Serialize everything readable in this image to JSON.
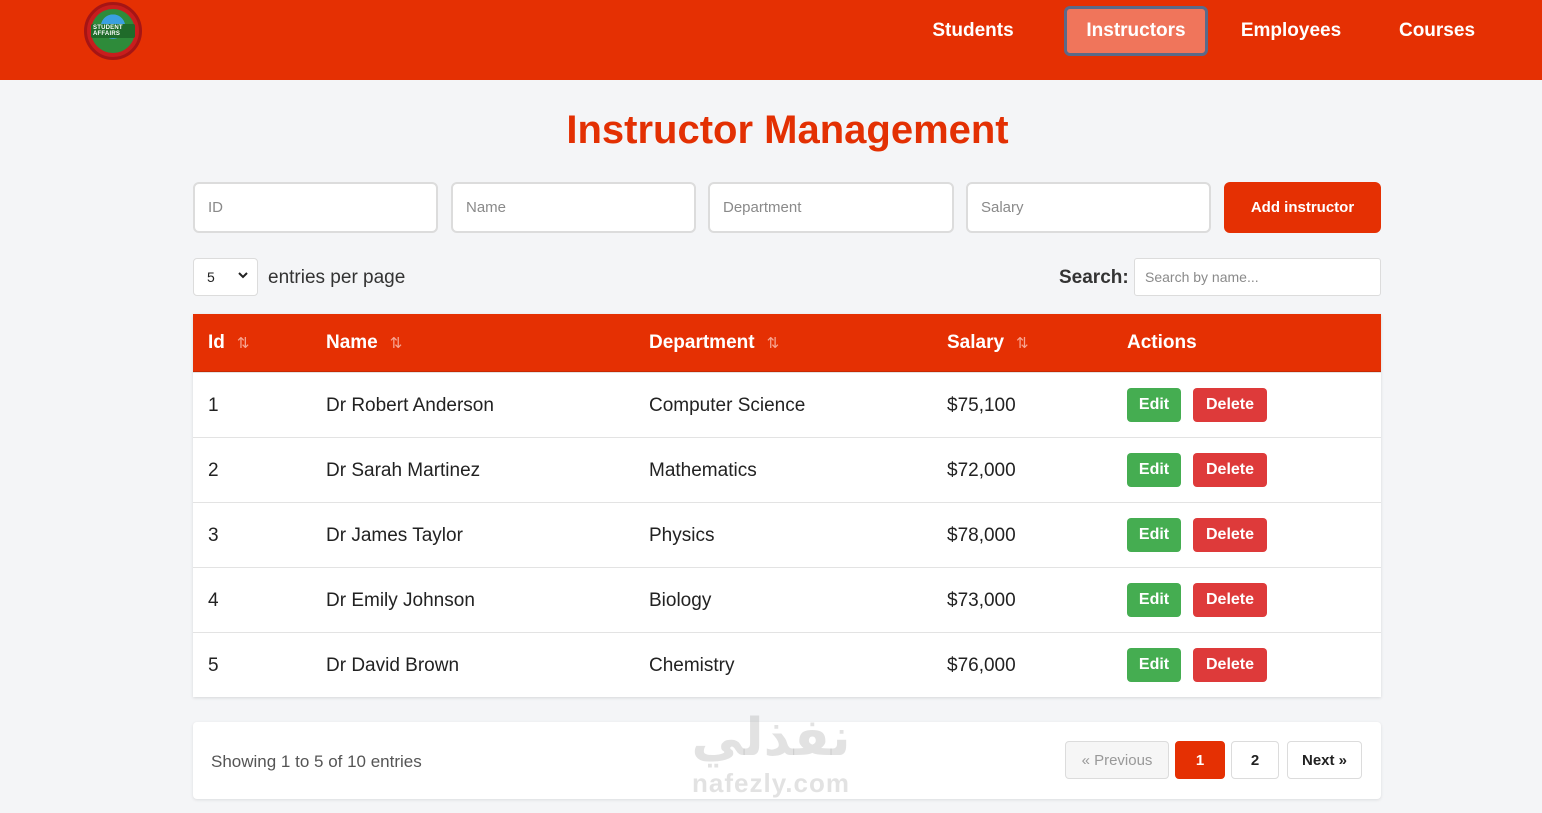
{
  "nav": {
    "logo_text": "STUDENT AFFAIRS",
    "links": [
      {
        "label": "Students",
        "active": false
      },
      {
        "label": "Instructors",
        "active": true
      },
      {
        "label": "Employees",
        "active": false
      },
      {
        "label": "Courses",
        "active": false
      }
    ]
  },
  "page": {
    "title": "Instructor Management"
  },
  "form": {
    "id_placeholder": "ID",
    "name_placeholder": "Name",
    "department_placeholder": "Department",
    "salary_placeholder": "Salary",
    "add_label": "Add instructor"
  },
  "controls": {
    "entries_value": "5",
    "entries_label": "entries per page",
    "search_label": "Search:",
    "search_placeholder": "Search by name..."
  },
  "table": {
    "headers": {
      "id": "Id",
      "name": "Name",
      "department": "Department",
      "salary": "Salary",
      "actions": "Actions"
    },
    "edit_label": "Edit",
    "delete_label": "Delete",
    "rows": [
      {
        "id": "1",
        "name": "Dr Robert Anderson",
        "department": "Computer Science",
        "salary": "$75,100"
      },
      {
        "id": "2",
        "name": "Dr Sarah Martinez",
        "department": "Mathematics",
        "salary": "$72,000"
      },
      {
        "id": "3",
        "name": "Dr James Taylor",
        "department": "Physics",
        "salary": "$78,000"
      },
      {
        "id": "4",
        "name": "Dr Emily Johnson",
        "department": "Biology",
        "salary": "$73,000"
      },
      {
        "id": "5",
        "name": "Dr David Brown",
        "department": "Chemistry",
        "salary": "$76,000"
      }
    ]
  },
  "footer": {
    "showing": "Showing 1 to 5 of 10 entries",
    "prev_label": "« Previous",
    "pages": [
      "1",
      "2"
    ],
    "next_label": "Next »"
  },
  "watermark": {
    "arabic": "نفذلي",
    "latin": "nafezly.com"
  },
  "colors": {
    "brand": "#e53003",
    "edit": "#45ad51",
    "delete": "#de3a3a"
  }
}
